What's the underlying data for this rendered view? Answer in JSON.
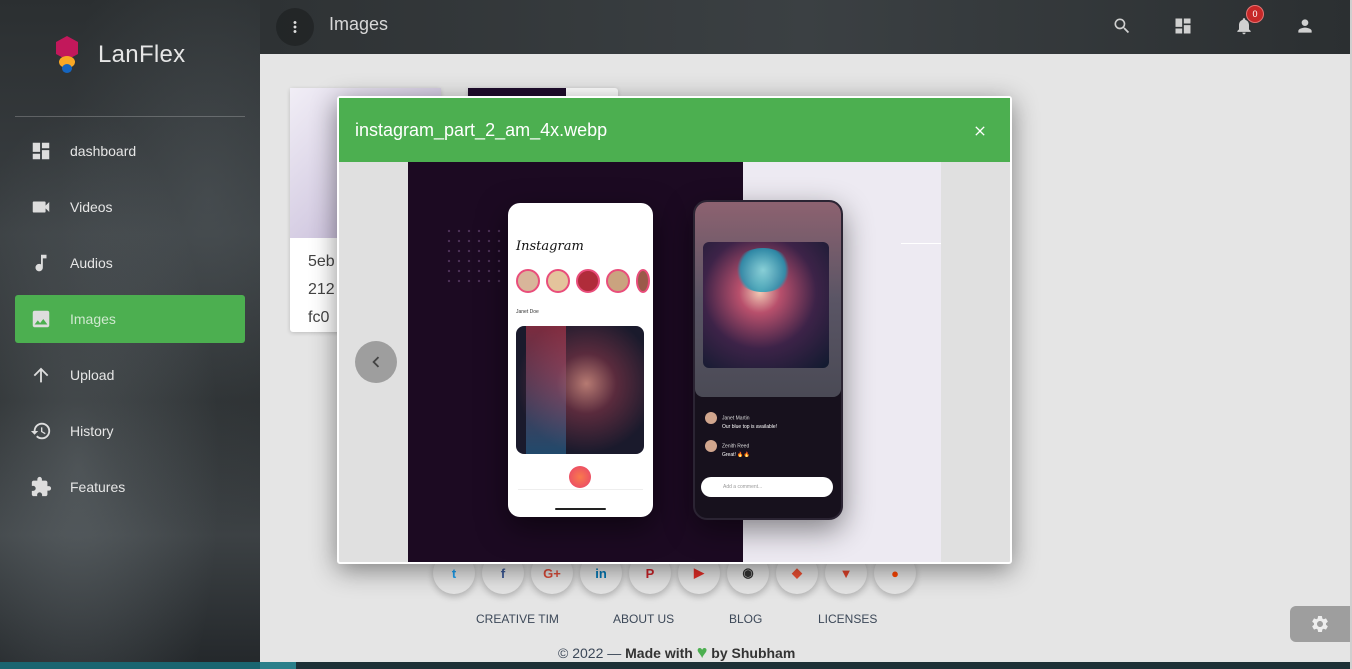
{
  "app": {
    "name": "LanFlex"
  },
  "sidebar": {
    "items": [
      {
        "label": "dashboard",
        "icon": "dashboard-icon"
      },
      {
        "label": "Videos",
        "icon": "videocam-icon"
      },
      {
        "label": "Audios",
        "icon": "music-note-icon"
      },
      {
        "label": "Images",
        "icon": "image-icon",
        "active": true
      },
      {
        "label": "Upload",
        "icon": "arrow-upward-icon"
      },
      {
        "label": "History",
        "icon": "history-icon"
      },
      {
        "label": "Features",
        "icon": "extension-icon"
      }
    ]
  },
  "header": {
    "title": "Images",
    "notifications_count": "0",
    "icons": [
      "search-icon",
      "dashboard-icon",
      "notifications-icon",
      "person-icon"
    ]
  },
  "gallery": {
    "cards": [
      {
        "name_lines": [
          "5eb",
          "212",
          "fc0"
        ]
      }
    ]
  },
  "footer": {
    "social": [
      {
        "icon": "twitter-icon",
        "glyph": "t",
        "color": "#1da1f2"
      },
      {
        "icon": "facebook-icon",
        "glyph": "f",
        "color": "#3b5998"
      },
      {
        "icon": "google-plus-icon",
        "glyph": "G+",
        "color": "#dd4b39"
      },
      {
        "icon": "linkedin-icon",
        "glyph": "in",
        "color": "#0077b5"
      },
      {
        "icon": "pinterest-icon",
        "glyph": "P",
        "color": "#cc2127"
      },
      {
        "icon": "youtube-icon",
        "glyph": "▶",
        "color": "#e52d27"
      },
      {
        "icon": "github-icon",
        "glyph": "◉",
        "color": "#333333"
      },
      {
        "icon": "git-icon",
        "glyph": "◆",
        "color": "#f05032"
      },
      {
        "icon": "gitlab-icon",
        "glyph": "▼",
        "color": "#e2432a"
      },
      {
        "icon": "reddit-icon",
        "glyph": "●",
        "color": "#ff4500"
      }
    ],
    "links": [
      "CREATIVE TIM",
      "ABOUT US",
      "BLOG",
      "LICENSES"
    ],
    "copyright_prefix": "© 2022 — ",
    "made_with": "Made with",
    "heart": "♥",
    "by": "by Shubham"
  },
  "modal": {
    "title": "instagram_part_2_am_4x.webp",
    "preview": {
      "app_logo": "Instagram",
      "post_user": "Janet Doe",
      "comments": [
        {
          "user": "Janet Martin",
          "text": "Our blue top is available!"
        },
        {
          "user": "Zenith Reed",
          "text": "Great! 🔥🔥"
        }
      ],
      "comment_placeholder": "Add a comment..."
    }
  },
  "colors": {
    "accent": "#4caf50",
    "badge": "#c62828"
  }
}
